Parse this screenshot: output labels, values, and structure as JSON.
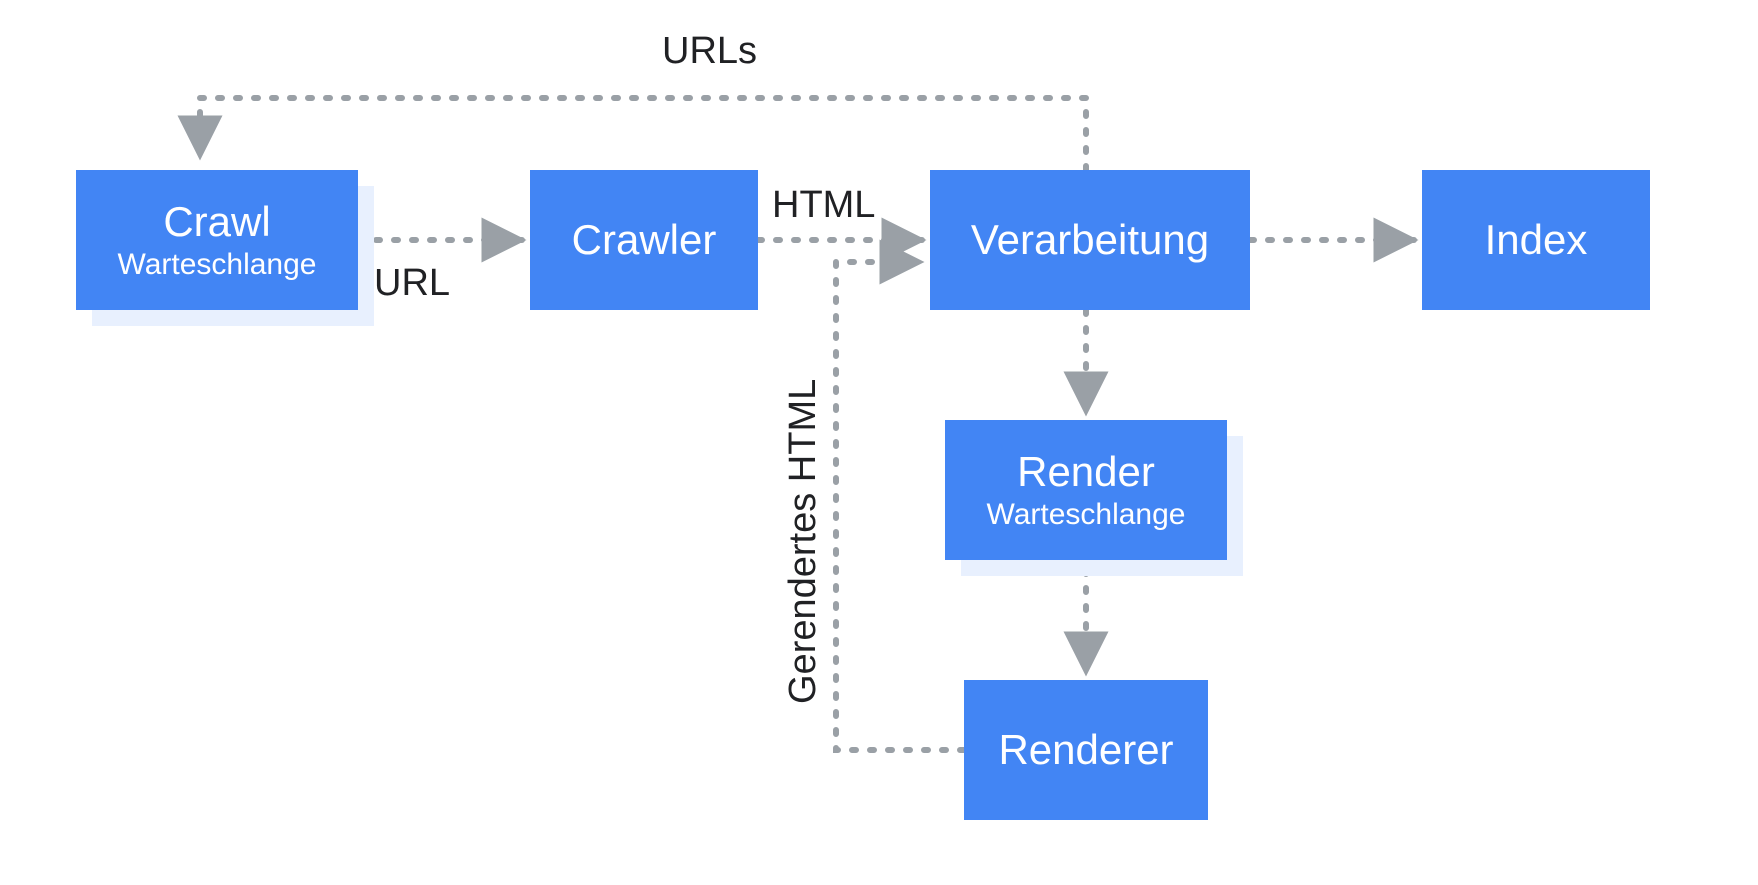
{
  "nodes": {
    "crawl_queue": {
      "title": "Crawl",
      "sub": "Warteschlange"
    },
    "crawler": {
      "title": "Crawler"
    },
    "processing": {
      "title": "Verarbeitung"
    },
    "index": {
      "title": "Index"
    },
    "render_queue": {
      "title": "Render",
      "sub": "Warteschlange"
    },
    "renderer": {
      "title": "Renderer"
    }
  },
  "edge_labels": {
    "urls": "URLs",
    "url": "URL",
    "html": "HTML",
    "rendered_html": "Gerendertes HTML"
  },
  "colors": {
    "node_fill": "#4285f4",
    "stack_shadow": "#e8f0fe",
    "connector": "#9aa0a6",
    "label_text": "#202124"
  }
}
